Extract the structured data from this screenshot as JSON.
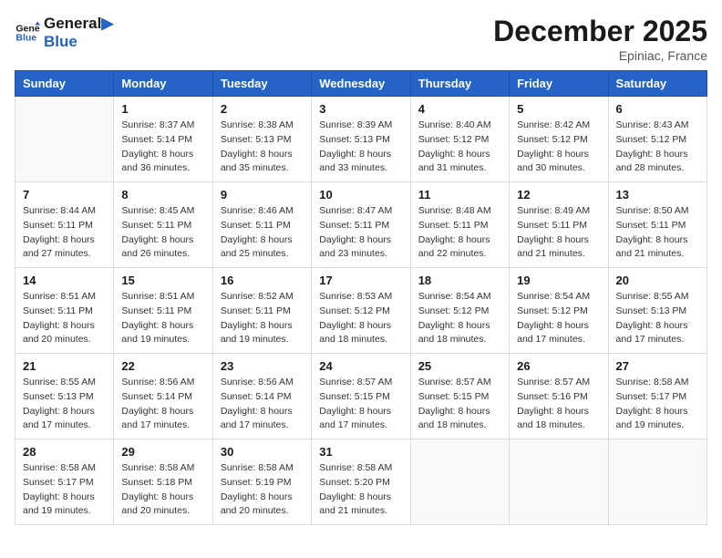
{
  "header": {
    "logo_line1": "General",
    "logo_line2": "Blue",
    "month": "December 2025",
    "location": "Epiniac, France"
  },
  "weekdays": [
    "Sunday",
    "Monday",
    "Tuesday",
    "Wednesday",
    "Thursday",
    "Friday",
    "Saturday"
  ],
  "weeks": [
    [
      {
        "day": "",
        "sunrise": "",
        "sunset": "",
        "daylight": ""
      },
      {
        "day": "1",
        "sunrise": "Sunrise: 8:37 AM",
        "sunset": "Sunset: 5:14 PM",
        "daylight": "Daylight: 8 hours and 36 minutes."
      },
      {
        "day": "2",
        "sunrise": "Sunrise: 8:38 AM",
        "sunset": "Sunset: 5:13 PM",
        "daylight": "Daylight: 8 hours and 35 minutes."
      },
      {
        "day": "3",
        "sunrise": "Sunrise: 8:39 AM",
        "sunset": "Sunset: 5:13 PM",
        "daylight": "Daylight: 8 hours and 33 minutes."
      },
      {
        "day": "4",
        "sunrise": "Sunrise: 8:40 AM",
        "sunset": "Sunset: 5:12 PM",
        "daylight": "Daylight: 8 hours and 31 minutes."
      },
      {
        "day": "5",
        "sunrise": "Sunrise: 8:42 AM",
        "sunset": "Sunset: 5:12 PM",
        "daylight": "Daylight: 8 hours and 30 minutes."
      },
      {
        "day": "6",
        "sunrise": "Sunrise: 8:43 AM",
        "sunset": "Sunset: 5:12 PM",
        "daylight": "Daylight: 8 hours and 28 minutes."
      }
    ],
    [
      {
        "day": "7",
        "sunrise": "Sunrise: 8:44 AM",
        "sunset": "Sunset: 5:11 PM",
        "daylight": "Daylight: 8 hours and 27 minutes."
      },
      {
        "day": "8",
        "sunrise": "Sunrise: 8:45 AM",
        "sunset": "Sunset: 5:11 PM",
        "daylight": "Daylight: 8 hours and 26 minutes."
      },
      {
        "day": "9",
        "sunrise": "Sunrise: 8:46 AM",
        "sunset": "Sunset: 5:11 PM",
        "daylight": "Daylight: 8 hours and 25 minutes."
      },
      {
        "day": "10",
        "sunrise": "Sunrise: 8:47 AM",
        "sunset": "Sunset: 5:11 PM",
        "daylight": "Daylight: 8 hours and 23 minutes."
      },
      {
        "day": "11",
        "sunrise": "Sunrise: 8:48 AM",
        "sunset": "Sunset: 5:11 PM",
        "daylight": "Daylight: 8 hours and 22 minutes."
      },
      {
        "day": "12",
        "sunrise": "Sunrise: 8:49 AM",
        "sunset": "Sunset: 5:11 PM",
        "daylight": "Daylight: 8 hours and 21 minutes."
      },
      {
        "day": "13",
        "sunrise": "Sunrise: 8:50 AM",
        "sunset": "Sunset: 5:11 PM",
        "daylight": "Daylight: 8 hours and 21 minutes."
      }
    ],
    [
      {
        "day": "14",
        "sunrise": "Sunrise: 8:51 AM",
        "sunset": "Sunset: 5:11 PM",
        "daylight": "Daylight: 8 hours and 20 minutes."
      },
      {
        "day": "15",
        "sunrise": "Sunrise: 8:51 AM",
        "sunset": "Sunset: 5:11 PM",
        "daylight": "Daylight: 8 hours and 19 minutes."
      },
      {
        "day": "16",
        "sunrise": "Sunrise: 8:52 AM",
        "sunset": "Sunset: 5:11 PM",
        "daylight": "Daylight: 8 hours and 19 minutes."
      },
      {
        "day": "17",
        "sunrise": "Sunrise: 8:53 AM",
        "sunset": "Sunset: 5:12 PM",
        "daylight": "Daylight: 8 hours and 18 minutes."
      },
      {
        "day": "18",
        "sunrise": "Sunrise: 8:54 AM",
        "sunset": "Sunset: 5:12 PM",
        "daylight": "Daylight: 8 hours and 18 minutes."
      },
      {
        "day": "19",
        "sunrise": "Sunrise: 8:54 AM",
        "sunset": "Sunset: 5:12 PM",
        "daylight": "Daylight: 8 hours and 17 minutes."
      },
      {
        "day": "20",
        "sunrise": "Sunrise: 8:55 AM",
        "sunset": "Sunset: 5:13 PM",
        "daylight": "Daylight: 8 hours and 17 minutes."
      }
    ],
    [
      {
        "day": "21",
        "sunrise": "Sunrise: 8:55 AM",
        "sunset": "Sunset: 5:13 PM",
        "daylight": "Daylight: 8 hours and 17 minutes."
      },
      {
        "day": "22",
        "sunrise": "Sunrise: 8:56 AM",
        "sunset": "Sunset: 5:14 PM",
        "daylight": "Daylight: 8 hours and 17 minutes."
      },
      {
        "day": "23",
        "sunrise": "Sunrise: 8:56 AM",
        "sunset": "Sunset: 5:14 PM",
        "daylight": "Daylight: 8 hours and 17 minutes."
      },
      {
        "day": "24",
        "sunrise": "Sunrise: 8:57 AM",
        "sunset": "Sunset: 5:15 PM",
        "daylight": "Daylight: 8 hours and 17 minutes."
      },
      {
        "day": "25",
        "sunrise": "Sunrise: 8:57 AM",
        "sunset": "Sunset: 5:15 PM",
        "daylight": "Daylight: 8 hours and 18 minutes."
      },
      {
        "day": "26",
        "sunrise": "Sunrise: 8:57 AM",
        "sunset": "Sunset: 5:16 PM",
        "daylight": "Daylight: 8 hours and 18 minutes."
      },
      {
        "day": "27",
        "sunrise": "Sunrise: 8:58 AM",
        "sunset": "Sunset: 5:17 PM",
        "daylight": "Daylight: 8 hours and 19 minutes."
      }
    ],
    [
      {
        "day": "28",
        "sunrise": "Sunrise: 8:58 AM",
        "sunset": "Sunset: 5:17 PM",
        "daylight": "Daylight: 8 hours and 19 minutes."
      },
      {
        "day": "29",
        "sunrise": "Sunrise: 8:58 AM",
        "sunset": "Sunset: 5:18 PM",
        "daylight": "Daylight: 8 hours and 20 minutes."
      },
      {
        "day": "30",
        "sunrise": "Sunrise: 8:58 AM",
        "sunset": "Sunset: 5:19 PM",
        "daylight": "Daylight: 8 hours and 20 minutes."
      },
      {
        "day": "31",
        "sunrise": "Sunrise: 8:58 AM",
        "sunset": "Sunset: 5:20 PM",
        "daylight": "Daylight: 8 hours and 21 minutes."
      },
      {
        "day": "",
        "sunrise": "",
        "sunset": "",
        "daylight": ""
      },
      {
        "day": "",
        "sunrise": "",
        "sunset": "",
        "daylight": ""
      },
      {
        "day": "",
        "sunrise": "",
        "sunset": "",
        "daylight": ""
      }
    ]
  ]
}
